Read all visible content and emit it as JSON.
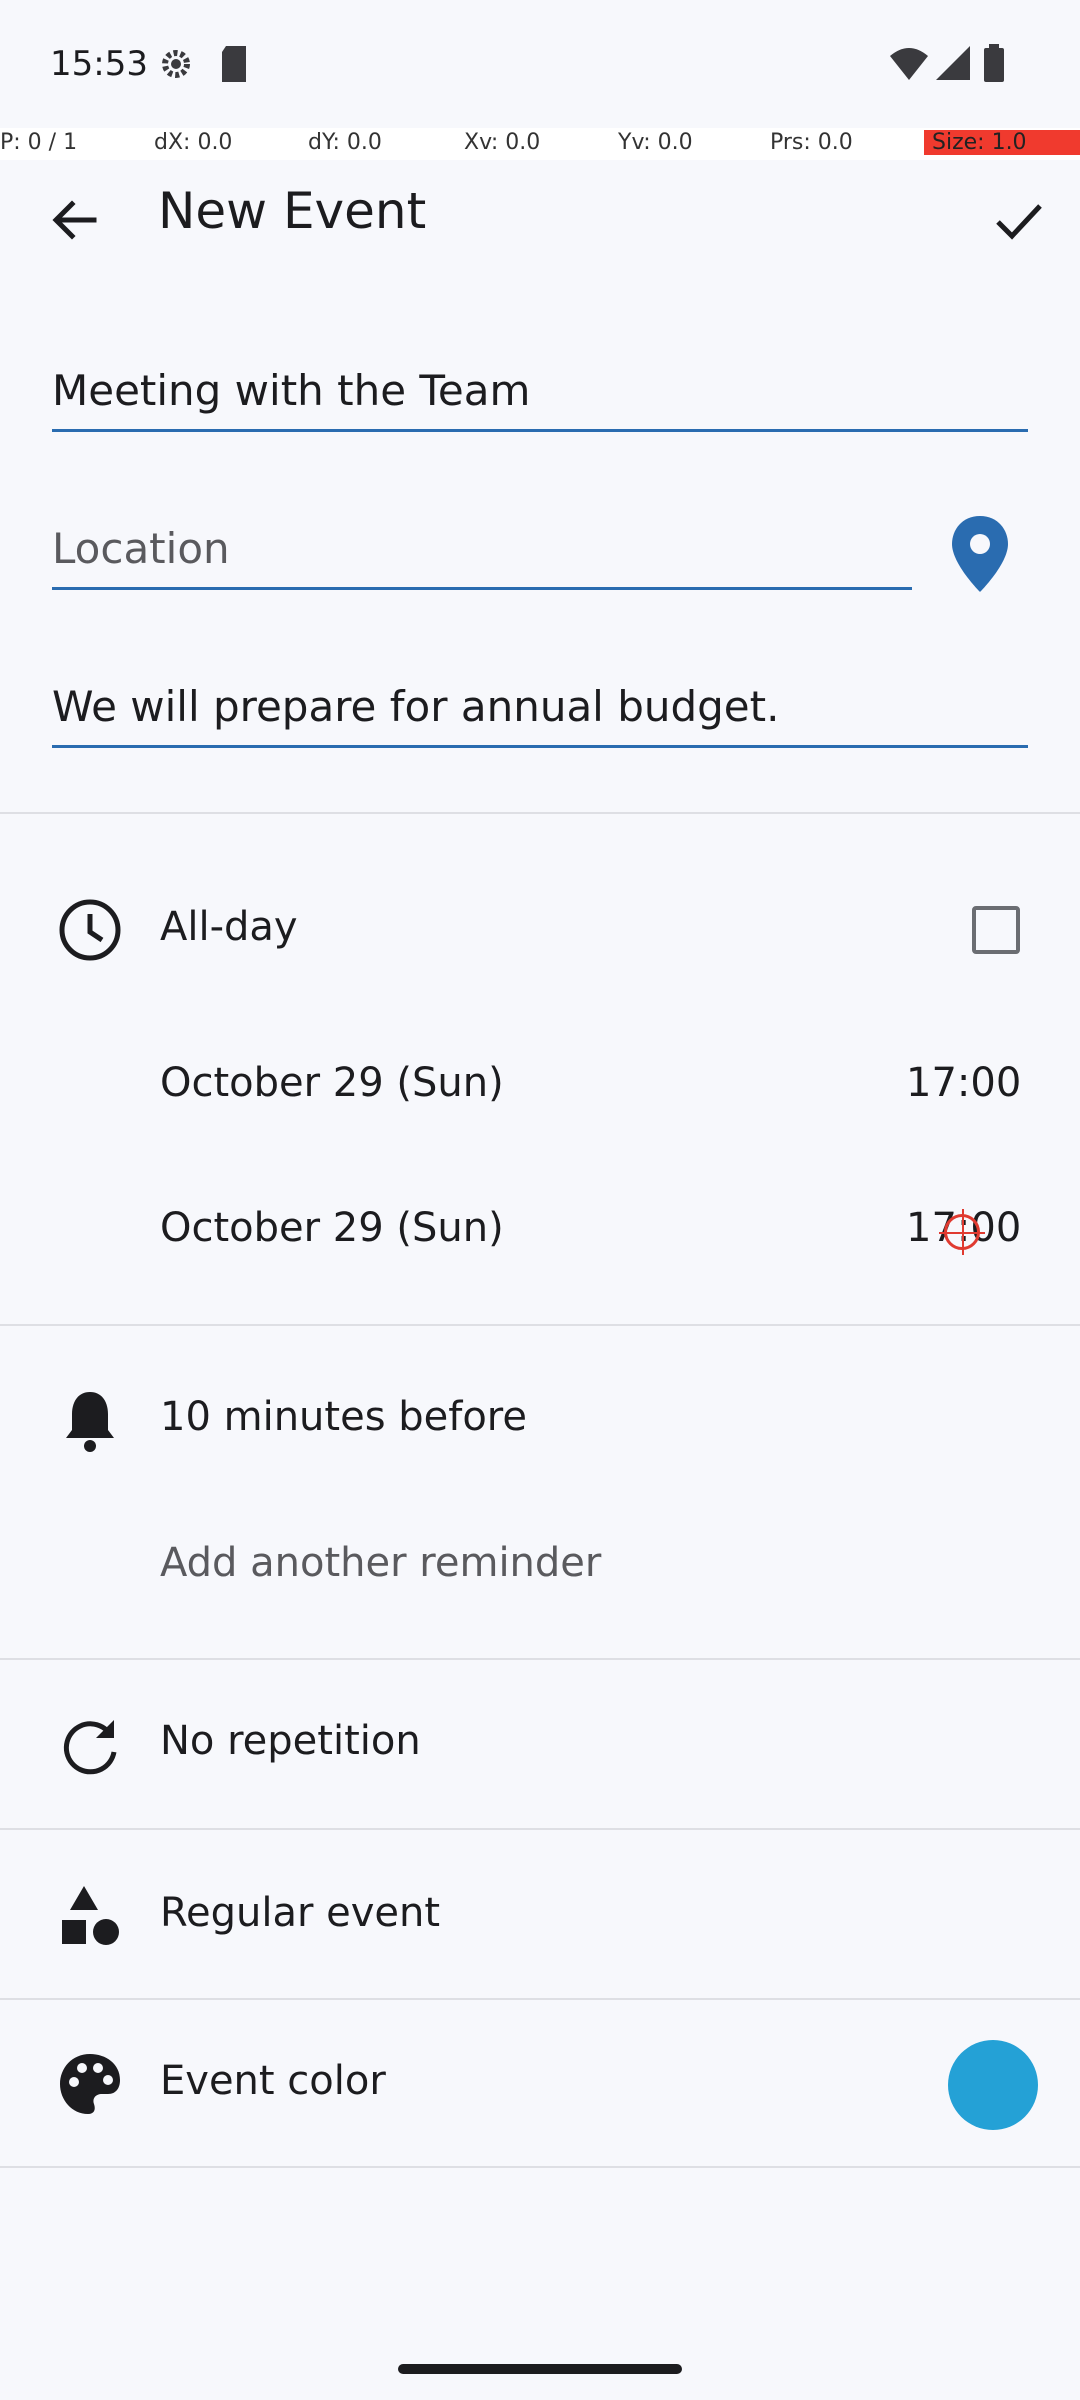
{
  "status_bar": {
    "time": "15:53"
  },
  "debug_bar": {
    "p": "P: 0 / 1",
    "dx": "dX: 0.0",
    "dy": "dY: 0.0",
    "xv": "Xv: 0.0",
    "yv": "Yv: 0.0",
    "prs": "Prs: 0.0",
    "size": "Size: 1.0"
  },
  "header": {
    "title": "New Event"
  },
  "form": {
    "title_value": "Meeting with the Team",
    "location_placeholder": "Location",
    "description_value": "We will prepare for annual budget."
  },
  "schedule": {
    "all_day_label": "All-day",
    "all_day_checked": false,
    "start_date": "October 29 (Sun)",
    "start_time": "17:00",
    "end_date": "October 29 (Sun)",
    "end_time": "17:00"
  },
  "reminders": {
    "current": "10 minutes before",
    "add_label": "Add another reminder"
  },
  "repetition": {
    "label": "No repetition"
  },
  "event_type": {
    "label": "Regular event"
  },
  "event_color": {
    "label": "Event color",
    "color": "#24a1d6"
  },
  "colors": {
    "accent": "#2a6cb0",
    "background": "#f7f8fc"
  }
}
